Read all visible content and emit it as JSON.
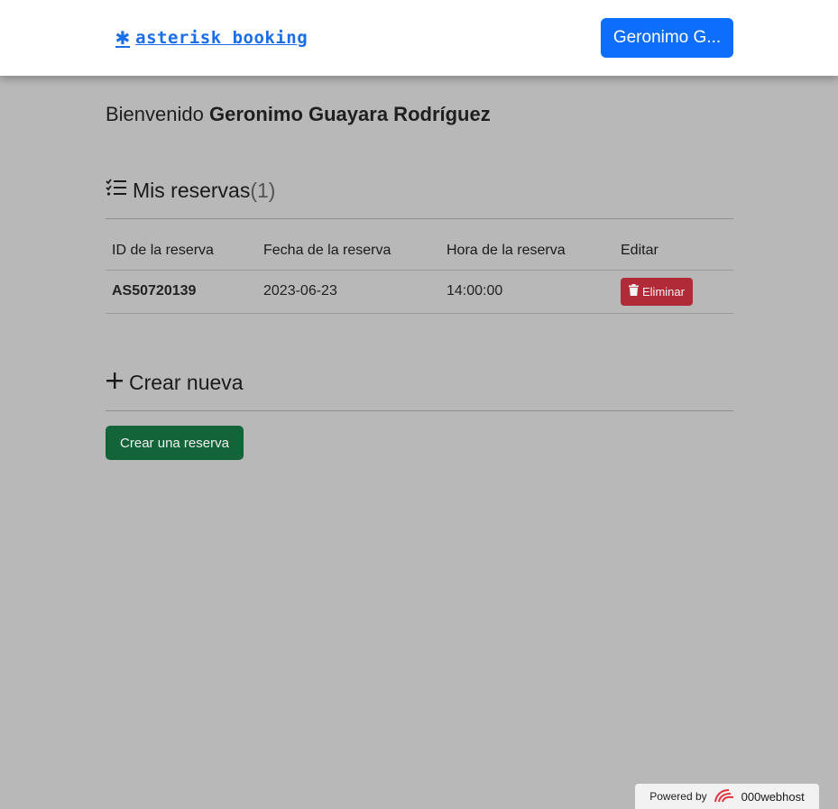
{
  "navbar": {
    "brand_icon": "✱",
    "brand_text": "asterisk booking",
    "user_button": "Geronimo G..."
  },
  "welcome": {
    "greeting": "Bienvenido",
    "user_name": "Geronimo Guayara Rodríguez"
  },
  "reservations": {
    "title": "Mis reservas",
    "count": "(1)",
    "columns": [
      "ID de la reserva",
      "Fecha de la reserva",
      "Hora de la reserva",
      "Editar"
    ],
    "rows": [
      {
        "id": "AS50720139",
        "date": "2023-06-23",
        "time": "14:00:00",
        "action": "Eliminar"
      }
    ]
  },
  "create": {
    "title": "Crear nueva",
    "button": "Crear una reserva"
  },
  "footer": {
    "powered_by": "Powered by",
    "host": "000webhost"
  },
  "colors": {
    "primary": "#0d6efd",
    "danger": "#b02a37",
    "success": "#14643a",
    "background": "#b8b8b8"
  }
}
